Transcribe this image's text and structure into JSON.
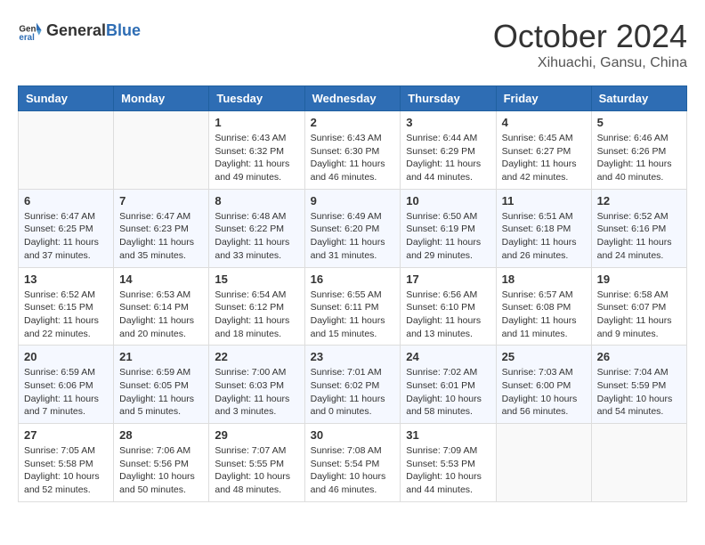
{
  "logo": {
    "general": "General",
    "blue": "Blue"
  },
  "title": "October 2024",
  "location": "Xihuachi, Gansu, China",
  "weekdays": [
    "Sunday",
    "Monday",
    "Tuesday",
    "Wednesday",
    "Thursday",
    "Friday",
    "Saturday"
  ],
  "weeks": [
    [
      {
        "day": "",
        "sunrise": "",
        "sunset": "",
        "daylight": ""
      },
      {
        "day": "",
        "sunrise": "",
        "sunset": "",
        "daylight": ""
      },
      {
        "day": "1",
        "sunrise": "Sunrise: 6:43 AM",
        "sunset": "Sunset: 6:32 PM",
        "daylight": "Daylight: 11 hours and 49 minutes."
      },
      {
        "day": "2",
        "sunrise": "Sunrise: 6:43 AM",
        "sunset": "Sunset: 6:30 PM",
        "daylight": "Daylight: 11 hours and 46 minutes."
      },
      {
        "day": "3",
        "sunrise": "Sunrise: 6:44 AM",
        "sunset": "Sunset: 6:29 PM",
        "daylight": "Daylight: 11 hours and 44 minutes."
      },
      {
        "day": "4",
        "sunrise": "Sunrise: 6:45 AM",
        "sunset": "Sunset: 6:27 PM",
        "daylight": "Daylight: 11 hours and 42 minutes."
      },
      {
        "day": "5",
        "sunrise": "Sunrise: 6:46 AM",
        "sunset": "Sunset: 6:26 PM",
        "daylight": "Daylight: 11 hours and 40 minutes."
      }
    ],
    [
      {
        "day": "6",
        "sunrise": "Sunrise: 6:47 AM",
        "sunset": "Sunset: 6:25 PM",
        "daylight": "Daylight: 11 hours and 37 minutes."
      },
      {
        "day": "7",
        "sunrise": "Sunrise: 6:47 AM",
        "sunset": "Sunset: 6:23 PM",
        "daylight": "Daylight: 11 hours and 35 minutes."
      },
      {
        "day": "8",
        "sunrise": "Sunrise: 6:48 AM",
        "sunset": "Sunset: 6:22 PM",
        "daylight": "Daylight: 11 hours and 33 minutes."
      },
      {
        "day": "9",
        "sunrise": "Sunrise: 6:49 AM",
        "sunset": "Sunset: 6:20 PM",
        "daylight": "Daylight: 11 hours and 31 minutes."
      },
      {
        "day": "10",
        "sunrise": "Sunrise: 6:50 AM",
        "sunset": "Sunset: 6:19 PM",
        "daylight": "Daylight: 11 hours and 29 minutes."
      },
      {
        "day": "11",
        "sunrise": "Sunrise: 6:51 AM",
        "sunset": "Sunset: 6:18 PM",
        "daylight": "Daylight: 11 hours and 26 minutes."
      },
      {
        "day": "12",
        "sunrise": "Sunrise: 6:52 AM",
        "sunset": "Sunset: 6:16 PM",
        "daylight": "Daylight: 11 hours and 24 minutes."
      }
    ],
    [
      {
        "day": "13",
        "sunrise": "Sunrise: 6:52 AM",
        "sunset": "Sunset: 6:15 PM",
        "daylight": "Daylight: 11 hours and 22 minutes."
      },
      {
        "day": "14",
        "sunrise": "Sunrise: 6:53 AM",
        "sunset": "Sunset: 6:14 PM",
        "daylight": "Daylight: 11 hours and 20 minutes."
      },
      {
        "day": "15",
        "sunrise": "Sunrise: 6:54 AM",
        "sunset": "Sunset: 6:12 PM",
        "daylight": "Daylight: 11 hours and 18 minutes."
      },
      {
        "day": "16",
        "sunrise": "Sunrise: 6:55 AM",
        "sunset": "Sunset: 6:11 PM",
        "daylight": "Daylight: 11 hours and 15 minutes."
      },
      {
        "day": "17",
        "sunrise": "Sunrise: 6:56 AM",
        "sunset": "Sunset: 6:10 PM",
        "daylight": "Daylight: 11 hours and 13 minutes."
      },
      {
        "day": "18",
        "sunrise": "Sunrise: 6:57 AM",
        "sunset": "Sunset: 6:08 PM",
        "daylight": "Daylight: 11 hours and 11 minutes."
      },
      {
        "day": "19",
        "sunrise": "Sunrise: 6:58 AM",
        "sunset": "Sunset: 6:07 PM",
        "daylight": "Daylight: 11 hours and 9 minutes."
      }
    ],
    [
      {
        "day": "20",
        "sunrise": "Sunrise: 6:59 AM",
        "sunset": "Sunset: 6:06 PM",
        "daylight": "Daylight: 11 hours and 7 minutes."
      },
      {
        "day": "21",
        "sunrise": "Sunrise: 6:59 AM",
        "sunset": "Sunset: 6:05 PM",
        "daylight": "Daylight: 11 hours and 5 minutes."
      },
      {
        "day": "22",
        "sunrise": "Sunrise: 7:00 AM",
        "sunset": "Sunset: 6:03 PM",
        "daylight": "Daylight: 11 hours and 3 minutes."
      },
      {
        "day": "23",
        "sunrise": "Sunrise: 7:01 AM",
        "sunset": "Sunset: 6:02 PM",
        "daylight": "Daylight: 11 hours and 0 minutes."
      },
      {
        "day": "24",
        "sunrise": "Sunrise: 7:02 AM",
        "sunset": "Sunset: 6:01 PM",
        "daylight": "Daylight: 10 hours and 58 minutes."
      },
      {
        "day": "25",
        "sunrise": "Sunrise: 7:03 AM",
        "sunset": "Sunset: 6:00 PM",
        "daylight": "Daylight: 10 hours and 56 minutes."
      },
      {
        "day": "26",
        "sunrise": "Sunrise: 7:04 AM",
        "sunset": "Sunset: 5:59 PM",
        "daylight": "Daylight: 10 hours and 54 minutes."
      }
    ],
    [
      {
        "day": "27",
        "sunrise": "Sunrise: 7:05 AM",
        "sunset": "Sunset: 5:58 PM",
        "daylight": "Daylight: 10 hours and 52 minutes."
      },
      {
        "day": "28",
        "sunrise": "Sunrise: 7:06 AM",
        "sunset": "Sunset: 5:56 PM",
        "daylight": "Daylight: 10 hours and 50 minutes."
      },
      {
        "day": "29",
        "sunrise": "Sunrise: 7:07 AM",
        "sunset": "Sunset: 5:55 PM",
        "daylight": "Daylight: 10 hours and 48 minutes."
      },
      {
        "day": "30",
        "sunrise": "Sunrise: 7:08 AM",
        "sunset": "Sunset: 5:54 PM",
        "daylight": "Daylight: 10 hours and 46 minutes."
      },
      {
        "day": "31",
        "sunrise": "Sunrise: 7:09 AM",
        "sunset": "Sunset: 5:53 PM",
        "daylight": "Daylight: 10 hours and 44 minutes."
      },
      {
        "day": "",
        "sunrise": "",
        "sunset": "",
        "daylight": ""
      },
      {
        "day": "",
        "sunrise": "",
        "sunset": "",
        "daylight": ""
      }
    ]
  ]
}
